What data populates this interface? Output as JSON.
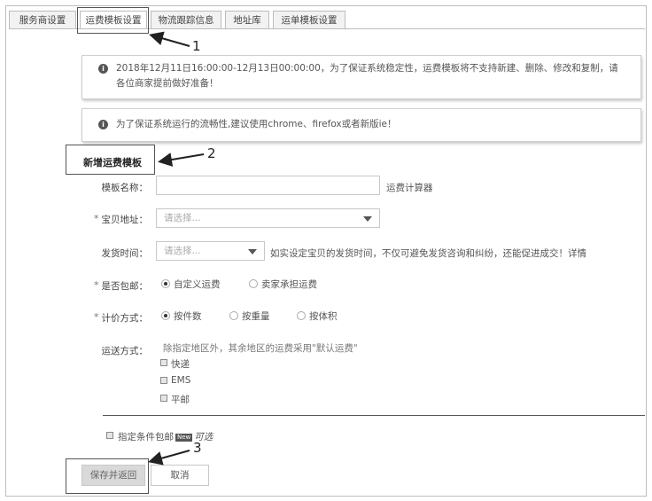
{
  "tabs": [
    "服务商设置",
    "运费模板设置",
    "物流跟踪信息",
    "地址库",
    "运单模板设置"
  ],
  "notices": [
    {
      "line1": "2018年12月11日16:00:00-12月13日00:00:00，为了保证系统稳定性，运费模板将不支持新建、删除、修改和复制，请",
      "line2": "各位商家提前做好准备！"
    },
    {
      "line1": "为了保证系统运行的流畅性,建议使用chrome、firefox或者新版ie！"
    }
  ],
  "section_title": "新增运费模板",
  "form": {
    "template_name_label": "模板名称：",
    "template_name_value": "",
    "calculator_link": "运费计算器",
    "location_label": "宝贝地址：",
    "location_placeholder": "请选择...",
    "ship_time_label": "发货时间：",
    "ship_time_placeholder": "请选择...",
    "ship_time_hint": "如实设定宝贝的发货时间，不仅可避免发货咨询和纠纷，还能促进成交！",
    "ship_time_link": "详情",
    "free_shipping_label": "是否包邮：",
    "free_shipping_options": [
      "自定义运费",
      "卖家承担运费"
    ],
    "pricing_label": "计价方式：",
    "pricing_options": [
      "按件数",
      "按重量",
      "按体积"
    ],
    "delivery_label": "运送方式：",
    "delivery_hint": "除指定地区外，其余地区的运费采用\"默认运费\"",
    "delivery_options": [
      "快递",
      "EMS",
      "平邮"
    ],
    "conditional_free": "指定条件包邮",
    "new_badge": "New",
    "optional": "可选",
    "required_mark": "*"
  },
  "buttons": {
    "save": "保存并返回",
    "cancel": "取消"
  },
  "callouts": [
    "1",
    "2",
    "3"
  ]
}
